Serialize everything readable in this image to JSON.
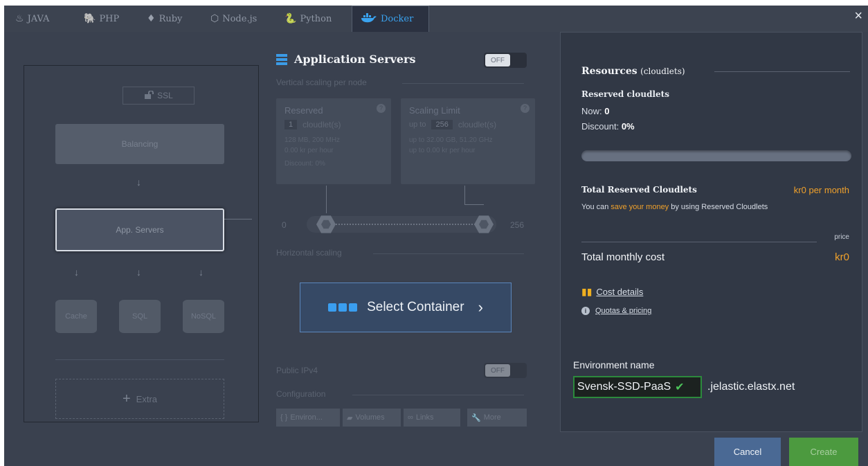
{
  "tabs": [
    {
      "label": "JAVA",
      "icon": "java-icon"
    },
    {
      "label": "PHP",
      "icon": "php-icon"
    },
    {
      "label": "Ruby",
      "icon": "ruby-icon"
    },
    {
      "label": "Node.js",
      "icon": "nodejs-icon"
    },
    {
      "label": "Python",
      "icon": "python-icon"
    },
    {
      "label": "Docker",
      "icon": "docker-icon",
      "active": true
    }
  ],
  "close_label": "×",
  "topology": {
    "ssl_label": "SSL",
    "balancing_label": "Balancing",
    "app_servers_label": "App. Servers",
    "cache_label": "Cache",
    "sql_label": "SQL",
    "nosql_label": "NoSQL",
    "extra_label": "Extra"
  },
  "config": {
    "title": "Application Servers",
    "toggle_label": "OFF",
    "vertical_scaling_label": "Vertical scaling per node",
    "reserved": {
      "title": "Reserved",
      "value": "1",
      "unit": "cloudlet(s)",
      "line1": "128 MB, 200 MHz",
      "line2": "0.00 kr per hour",
      "line3": "Discount: 0%"
    },
    "scaling_limit": {
      "title": "Scaling Limit",
      "prefix": "up to",
      "value": "256",
      "unit": "cloudlet(s)",
      "line1": "up to 32.00 GB, 51.20 GHz",
      "line2": "up to 0.00 kr per hour"
    },
    "slider": {
      "min": "0",
      "max": "256",
      "reserved": 1,
      "limit": 256
    },
    "horizontal_scaling_label": "Horizontal scaling",
    "select_container_label": "Select Container",
    "public_ipv4_label": "Public IPv4",
    "public_ipv4_toggle": "OFF",
    "configuration_label": "Configuration",
    "config_buttons": [
      "Environ...",
      "Volumes",
      "Links",
      "More"
    ]
  },
  "resources": {
    "title": "Resources",
    "title_suffix": "(cloudlets)",
    "reserved_cloudlets_label": "Reserved cloudlets",
    "now_label": "Now:",
    "now_value": "0",
    "discount_label": "Discount:",
    "discount_value": "0%",
    "total_reserved_label": "Total Reserved Cloudlets",
    "total_reserved_value": "kr0 per month",
    "save_text_before": "You can",
    "save_link": "save your money",
    "save_text_after": "by using Reserved Cloudlets",
    "price_label": "price",
    "total_monthly_label": "Total monthly cost",
    "total_monthly_value": "kr0",
    "cost_details_label": "Cost details",
    "quotas_label": "Quotas & pricing",
    "env_name_label": "Environment name",
    "env_name_value": "Svensk-SSD-PaaS",
    "env_domain": ".jelastic.elastx.net"
  },
  "footer": {
    "cancel_label": "Cancel",
    "create_label": "Create"
  },
  "colors": {
    "accent_blue": "#3aa3f0",
    "orange": "#f0a12b",
    "green_ok": "#4cc45a",
    "create_green": "#4c9a3f",
    "cancel_blue": "#4a6994"
  }
}
